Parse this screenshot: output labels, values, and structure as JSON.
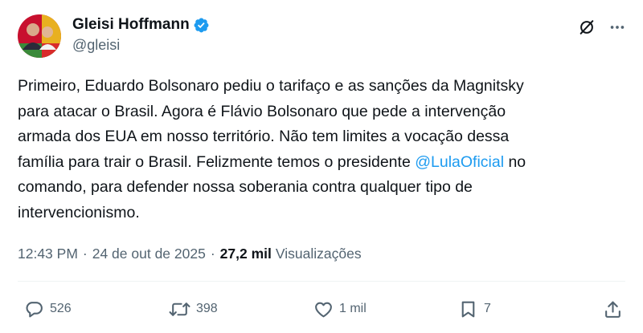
{
  "author": {
    "display_name": "Gleisi Hoffmann",
    "handle": "@gleisi",
    "verified": true,
    "verified_color": "#1d9bf0"
  },
  "tweet": {
    "text_before_mention": "Primeiro, Eduardo Bolsonaro pediu o tarifaço e as sanções da Magnitsky\npara atacar o Brasil. Agora é Flávio Bolsonaro que pede a intervenção\narmada dos EUA em nosso território. Não tem limites a vocação dessa\nfamília para trair o Brasil. Felizmente temos o presidente ",
    "mention": "@LulaOficial",
    "text_after_mention": " no\ncomando, para defender nossa soberania contra qualquer tipo de\nintervencionismo.",
    "mention_color": "#1d9bf0"
  },
  "meta": {
    "time": "12:43 PM",
    "separator": "·",
    "date": "24 de out de 2025",
    "views_count": "27,2 mil",
    "views_label": "Visualizações"
  },
  "actions": {
    "replies": "526",
    "reposts": "398",
    "likes": "1 mil",
    "bookmarks": "7"
  },
  "icons": {
    "grok": "grok-slash-circle-icon",
    "more": "more-dots-icon",
    "reply": "reply-bubble-icon",
    "repost": "repost-arrows-icon",
    "like": "heart-icon",
    "bookmark": "bookmark-icon",
    "share": "share-upload-icon"
  },
  "colors": {
    "text": "#0f1419",
    "secondary": "#536471",
    "divider": "#eff3f4"
  }
}
